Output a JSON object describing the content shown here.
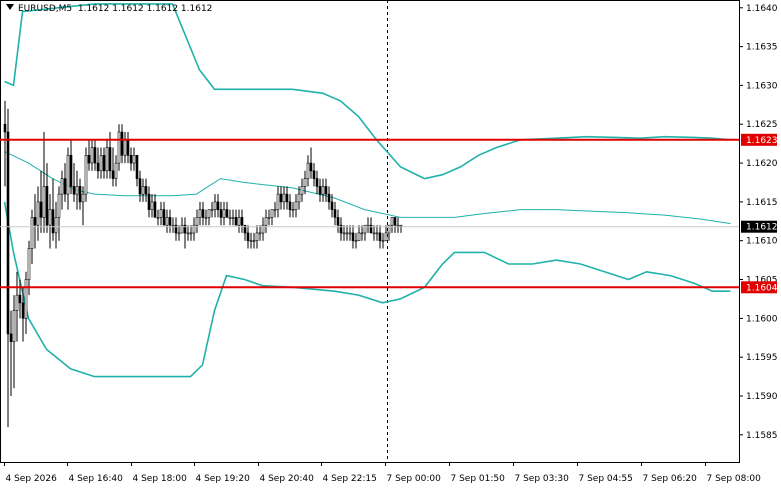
{
  "header": {
    "symbol": "EURUSD,M5",
    "ohlc": "1.1612 1.1612 1.1612 1.1612"
  },
  "chart_data": {
    "type": "candlestick",
    "symbol": "EURUSD",
    "timeframe": "M5",
    "ylim": [
      1.15815,
      1.1641
    ],
    "y_ticks": [
      "1.1640",
      "1.1635",
      "1.1630",
      "1.1625",
      "1.1620",
      "1.1615",
      "1.1610",
      "1.1605",
      "1.1600",
      "1.1595",
      "1.1590",
      "1.1585"
    ],
    "x_ticks": [
      "4 Sep 2026",
      "4 Sep 16:40",
      "4 Sep 18:00",
      "4 Sep 19:20",
      "4 Sep 20:40",
      "4 Sep 22:15",
      "7 Sep 00:00",
      "7 Sep 01:50",
      "7 Sep 03:30",
      "7 Sep 04:55",
      "7 Sep 06:20",
      "7 Sep 08:00"
    ],
    "levels": [
      {
        "label": "1.1623",
        "value": 1.1623,
        "color": "#e00000"
      },
      {
        "label": "1.1604",
        "value": 1.1604,
        "color": "#e00000"
      }
    ],
    "current_price": {
      "label": "1.1612",
      "value": 1.16118
    },
    "session_break_tick": "7 Sep 00:00",
    "bollinger_color": "#20b2aa",
    "candle_color": "#000000",
    "candles": [
      [
        1.1625,
        1.1628,
        1.1617,
        1.1624
      ],
      [
        1.1624,
        1.1627,
        1.1586,
        1.1598
      ],
      [
        1.1598,
        1.1601,
        1.159,
        1.1597
      ],
      [
        1.1597,
        1.1603,
        1.1591,
        1.1601
      ],
      [
        1.1601,
        1.1606,
        1.1597,
        1.1603
      ],
      [
        1.1603,
        1.1605,
        1.16,
        1.1602
      ],
      [
        1.1602,
        1.1604,
        1.1597,
        1.16
      ],
      [
        1.16,
        1.1606,
        1.1598,
        1.1605
      ],
      [
        1.1605,
        1.161,
        1.1603,
        1.1609
      ],
      [
        1.1609,
        1.1614,
        1.1607,
        1.1613
      ],
      [
        1.1613,
        1.1616,
        1.1609,
        1.1612
      ],
      [
        1.1612,
        1.1617,
        1.161,
        1.1615
      ],
      [
        1.1615,
        1.1619,
        1.1611,
        1.1613
      ],
      [
        1.1613,
        1.1624,
        1.1611,
        1.1617
      ],
      [
        1.1617,
        1.162,
        1.1611,
        1.1612
      ],
      [
        1.1612,
        1.1616,
        1.1609,
        1.1614
      ],
      [
        1.1614,
        1.1618,
        1.161,
        1.1611
      ],
      [
        1.1611,
        1.1615,
        1.1609,
        1.1613
      ],
      [
        1.1613,
        1.1617,
        1.161,
        1.1616
      ],
      [
        1.1616,
        1.1619,
        1.1614,
        1.1618
      ],
      [
        1.1618,
        1.162,
        1.1615,
        1.1616
      ],
      [
        1.1616,
        1.1622,
        1.1614,
        1.1621
      ],
      [
        1.1621,
        1.1623,
        1.1616,
        1.1617
      ],
      [
        1.1617,
        1.162,
        1.1615,
        1.1616
      ],
      [
        1.1616,
        1.1619,
        1.1614,
        1.1617
      ],
      [
        1.1617,
        1.1618,
        1.1614,
        1.1615
      ],
      [
        1.1615,
        1.1617,
        1.1612,
        1.1616
      ],
      [
        1.1616,
        1.1622,
        1.1615,
        1.1621
      ],
      [
        1.1621,
        1.1623,
        1.1619,
        1.162
      ],
      [
        1.162,
        1.1623,
        1.1619,
        1.1622
      ],
      [
        1.1622,
        1.1623,
        1.1619,
        1.162
      ],
      [
        1.162,
        1.1622,
        1.1618,
        1.1619
      ],
      [
        1.1619,
        1.1622,
        1.1618,
        1.1621
      ],
      [
        1.1621,
        1.1622,
        1.1618,
        1.1619
      ],
      [
        1.1619,
        1.1623,
        1.1618,
        1.1622
      ],
      [
        1.1622,
        1.1624,
        1.1618,
        1.1619
      ],
      [
        1.1619,
        1.1622,
        1.1617,
        1.1618
      ],
      [
        1.1618,
        1.1621,
        1.1617,
        1.162
      ],
      [
        1.162,
        1.1625,
        1.1619,
        1.1624
      ],
      [
        1.1624,
        1.1625,
        1.162,
        1.1621
      ],
      [
        1.1621,
        1.1624,
        1.162,
        1.1623
      ],
      [
        1.1623,
        1.1624,
        1.162,
        1.1621
      ],
      [
        1.1621,
        1.1622,
        1.1619,
        1.162
      ],
      [
        1.162,
        1.1622,
        1.1619,
        1.1621
      ],
      [
        1.1621,
        1.1621,
        1.1617,
        1.1618
      ],
      [
        1.1618,
        1.1619,
        1.1615,
        1.1616
      ],
      [
        1.1616,
        1.1618,
        1.1615,
        1.1617
      ],
      [
        1.1617,
        1.1618,
        1.1615,
        1.1616
      ],
      [
        1.1616,
        1.1617,
        1.1613,
        1.1614
      ],
      [
        1.1614,
        1.1616,
        1.1613,
        1.1615
      ],
      [
        1.1615,
        1.1616,
        1.1613,
        1.1613
      ],
      [
        1.1613,
        1.1614,
        1.1612,
        1.1613
      ],
      [
        1.1613,
        1.1615,
        1.1612,
        1.1614
      ],
      [
        1.1614,
        1.1615,
        1.1612,
        1.1612
      ],
      [
        1.1612,
        1.1614,
        1.1611,
        1.1613
      ],
      [
        1.1613,
        1.1614,
        1.1611,
        1.1612
      ],
      [
        1.1612,
        1.1613,
        1.1611,
        1.1612
      ],
      [
        1.1612,
        1.1613,
        1.161,
        1.1611
      ],
      [
        1.1611,
        1.1612,
        1.161,
        1.1611
      ],
      [
        1.1611,
        1.1613,
        1.1611,
        1.1612
      ],
      [
        1.1612,
        1.1613,
        1.1609,
        1.1611
      ],
      [
        1.1611,
        1.1612,
        1.161,
        1.1611
      ],
      [
        1.1611,
        1.1612,
        1.161,
        1.1611
      ],
      [
        1.1611,
        1.1613,
        1.161,
        1.1612
      ],
      [
        1.1612,
        1.1614,
        1.1611,
        1.1613
      ],
      [
        1.1613,
        1.1615,
        1.1612,
        1.1614
      ],
      [
        1.1614,
        1.1615,
        1.1612,
        1.1613
      ],
      [
        1.1613,
        1.1614,
        1.1612,
        1.1613
      ],
      [
        1.1613,
        1.1614,
        1.1612,
        1.1614
      ],
      [
        1.1614,
        1.1615,
        1.1613,
        1.1614
      ],
      [
        1.1614,
        1.1616,
        1.1613,
        1.1615
      ],
      [
        1.1615,
        1.1616,
        1.1613,
        1.1614
      ],
      [
        1.1614,
        1.1615,
        1.1612,
        1.1613
      ],
      [
        1.1613,
        1.1615,
        1.1612,
        1.1614
      ],
      [
        1.1614,
        1.1615,
        1.1613,
        1.1613
      ],
      [
        1.1613,
        1.1614,
        1.1612,
        1.1613
      ],
      [
        1.1613,
        1.1614,
        1.1612,
        1.1613
      ],
      [
        1.1613,
        1.1614,
        1.1612,
        1.1612
      ],
      [
        1.1612,
        1.1614,
        1.1611,
        1.1613
      ],
      [
        1.1613,
        1.1614,
        1.1611,
        1.1612
      ],
      [
        1.1612,
        1.1612,
        1.161,
        1.1611
      ],
      [
        1.1611,
        1.1612,
        1.1609,
        1.161
      ],
      [
        1.161,
        1.1611,
        1.1609,
        1.161
      ],
      [
        1.161,
        1.1611,
        1.1609,
        1.161
      ],
      [
        1.161,
        1.1612,
        1.1609,
        1.1611
      ],
      [
        1.1611,
        1.1612,
        1.161,
        1.1611
      ],
      [
        1.1611,
        1.1613,
        1.161,
        1.1612
      ],
      [
        1.1612,
        1.1614,
        1.1611,
        1.1613
      ],
      [
        1.1613,
        1.1614,
        1.1612,
        1.1613
      ],
      [
        1.1613,
        1.1614,
        1.1612,
        1.1614
      ],
      [
        1.1614,
        1.1615,
        1.1613,
        1.1614
      ],
      [
        1.1614,
        1.1617,
        1.1613,
        1.1616
      ],
      [
        1.1616,
        1.1617,
        1.1614,
        1.1615
      ],
      [
        1.1615,
        1.1617,
        1.1614,
        1.1616
      ],
      [
        1.1616,
        1.1617,
        1.1614,
        1.1615
      ],
      [
        1.1615,
        1.1616,
        1.1613,
        1.1614
      ],
      [
        1.1614,
        1.1615,
        1.1613,
        1.1614
      ],
      [
        1.1614,
        1.1616,
        1.1613,
        1.1615
      ],
      [
        1.1615,
        1.1617,
        1.1614,
        1.1616
      ],
      [
        1.1616,
        1.1618,
        1.1615,
        1.1617
      ],
      [
        1.1617,
        1.1619,
        1.1616,
        1.1618
      ],
      [
        1.1618,
        1.1621,
        1.1617,
        1.162
      ],
      [
        1.162,
        1.1622,
        1.1618,
        1.1619
      ],
      [
        1.1619,
        1.162,
        1.1617,
        1.1618
      ],
      [
        1.1618,
        1.1619,
        1.1616,
        1.1617
      ],
      [
        1.1617,
        1.1618,
        1.1615,
        1.1616
      ],
      [
        1.1616,
        1.1618,
        1.1615,
        1.1617
      ],
      [
        1.1617,
        1.1618,
        1.1615,
        1.1616
      ],
      [
        1.1616,
        1.1617,
        1.1614,
        1.1615
      ],
      [
        1.1615,
        1.1616,
        1.1613,
        1.1614
      ],
      [
        1.1614,
        1.1615,
        1.1612,
        1.1613
      ],
      [
        1.1613,
        1.1614,
        1.1611,
        1.1612
      ],
      [
        1.1612,
        1.1613,
        1.161,
        1.1611
      ],
      [
        1.1611,
        1.1612,
        1.161,
        1.1611
      ],
      [
        1.1611,
        1.1612,
        1.161,
        1.1611
      ],
      [
        1.1611,
        1.1612,
        1.161,
        1.1611
      ],
      [
        1.1611,
        1.1612,
        1.1609,
        1.161
      ],
      [
        1.161,
        1.1611,
        1.1609,
        1.161
      ],
      [
        1.161,
        1.1612,
        1.161,
        1.1611
      ],
      [
        1.1611,
        1.1612,
        1.161,
        1.1611
      ],
      [
        1.1611,
        1.1612,
        1.161,
        1.1612
      ],
      [
        1.1612,
        1.1613,
        1.1611,
        1.1612
      ],
      [
        1.1612,
        1.1613,
        1.1611,
        1.1611
      ],
      [
        1.1611,
        1.1612,
        1.161,
        1.1611
      ],
      [
        1.1611,
        1.1612,
        1.161,
        1.1611
      ],
      [
        1.1611,
        1.1612,
        1.1609,
        1.161
      ],
      [
        1.161,
        1.1611,
        1.1609,
        1.161
      ],
      [
        1.161,
        1.1612,
        1.161,
        1.1611
      ],
      [
        1.1611,
        1.1612,
        1.161,
        1.1612
      ],
      [
        1.1612,
        1.1613,
        1.1611,
        1.1613
      ],
      [
        1.1613,
        1.1613,
        1.1611,
        1.1612
      ],
      [
        1.1612,
        1.1613,
        1.1611,
        1.1612
      ],
      [
        1.1612,
        1.1612,
        1.1611,
        1.1612
      ]
    ],
    "bollinger": {
      "upper": [
        [
          0,
          1.16305
        ],
        [
          3,
          1.163
        ],
        [
          6,
          1.16395
        ],
        [
          30,
          1.16405
        ],
        [
          56,
          1.16405
        ],
        [
          65,
          1.1632
        ],
        [
          70,
          1.16295
        ],
        [
          80,
          1.16295
        ],
        [
          96,
          1.16295
        ],
        [
          106,
          1.1629
        ],
        [
          112,
          1.1628
        ],
        [
          118,
          1.1626
        ],
        [
          124,
          1.1623
        ],
        [
          132,
          1.16195
        ],
        [
          140,
          1.1618
        ],
        [
          146,
          1.16185
        ],
        [
          152,
          1.16195
        ],
        [
          158,
          1.1621
        ],
        [
          164,
          1.1622
        ],
        [
          172,
          1.1623
        ],
        [
          184,
          1.16232
        ],
        [
          194,
          1.16234
        ],
        [
          204,
          1.16233
        ],
        [
          212,
          1.16232
        ],
        [
          220,
          1.16234
        ],
        [
          230,
          1.16233
        ],
        [
          236,
          1.16232
        ],
        [
          242,
          1.1623
        ]
      ],
      "middle": [
        [
          0,
          1.16215
        ],
        [
          8,
          1.162
        ],
        [
          16,
          1.1618
        ],
        [
          24,
          1.16165
        ],
        [
          30,
          1.1616
        ],
        [
          40,
          1.16158
        ],
        [
          56,
          1.16158
        ],
        [
          64,
          1.1616
        ],
        [
          72,
          1.1618
        ],
        [
          80,
          1.16175
        ],
        [
          96,
          1.16168
        ],
        [
          110,
          1.16155
        ],
        [
          120,
          1.1614
        ],
        [
          132,
          1.1613
        ],
        [
          140,
          1.1613
        ],
        [
          150,
          1.1613
        ],
        [
          160,
          1.16135
        ],
        [
          172,
          1.1614
        ],
        [
          184,
          1.1614
        ],
        [
          196,
          1.16138
        ],
        [
          208,
          1.16136
        ],
        [
          220,
          1.16133
        ],
        [
          232,
          1.16128
        ],
        [
          242,
          1.16122
        ]
      ],
      "lower": [
        [
          0,
          1.1615
        ],
        [
          3,
          1.16085
        ],
        [
          8,
          1.16
        ],
        [
          14,
          1.1596
        ],
        [
          22,
          1.15935
        ],
        [
          30,
          1.15925
        ],
        [
          50,
          1.15925
        ],
        [
          62,
          1.15925
        ],
        [
          66,
          1.1594
        ],
        [
          70,
          1.1601
        ],
        [
          74,
          1.16055
        ],
        [
          80,
          1.1605
        ],
        [
          86,
          1.16042
        ],
        [
          96,
          1.1604
        ],
        [
          110,
          1.16035
        ],
        [
          118,
          1.1603
        ],
        [
          126,
          1.1602
        ],
        [
          132,
          1.16025
        ],
        [
          140,
          1.1604
        ],
        [
          146,
          1.1607
        ],
        [
          150,
          1.16085
        ],
        [
          160,
          1.16085
        ],
        [
          168,
          1.1607
        ],
        [
          176,
          1.1607
        ],
        [
          184,
          1.16075
        ],
        [
          192,
          1.1607
        ],
        [
          200,
          1.1606
        ],
        [
          208,
          1.1605
        ],
        [
          214,
          1.1606
        ],
        [
          222,
          1.16055
        ],
        [
          230,
          1.16045
        ],
        [
          236,
          1.16035
        ],
        [
          242,
          1.16035
        ]
      ]
    }
  }
}
